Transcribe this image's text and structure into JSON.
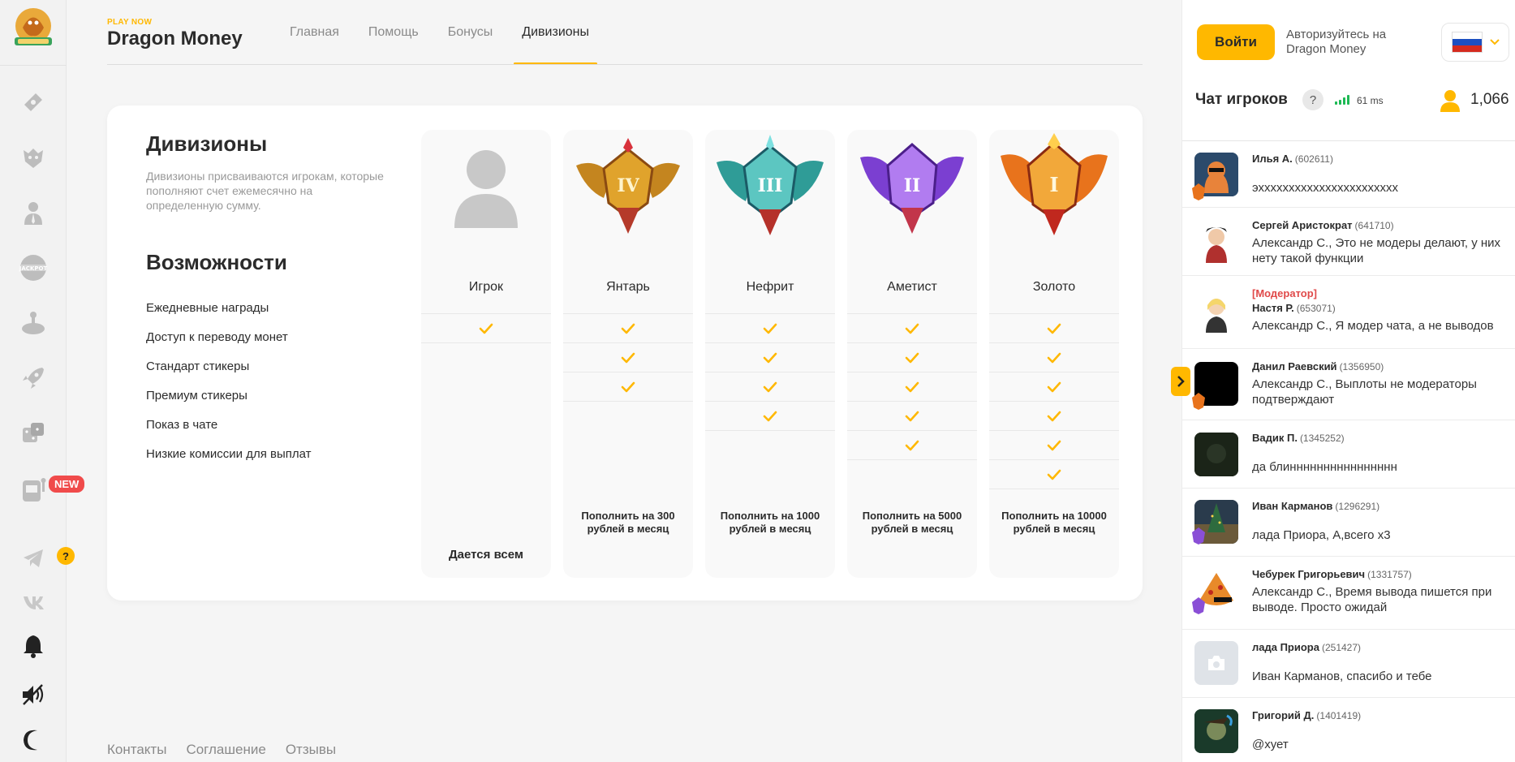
{
  "brand": {
    "small": "PLAY NOW",
    "name": "Dragon Money"
  },
  "nav": [
    "Главная",
    "Помощь",
    "Бонусы",
    "Дивизионы"
  ],
  "sidebar": {
    "icons": [
      "ticket-icon",
      "tiger-icon",
      "agent-icon",
      "jackpot-icon",
      "joystick-icon",
      "rocket-icon",
      "dice-icon",
      "slot-machine-icon"
    ],
    "new_badge": "NEW",
    "help_badge": "?",
    "bottom_icons": [
      "telegram-icon",
      "vk-icon",
      "bell-icon",
      "sound-off-icon",
      "moon-icon"
    ]
  },
  "card": {
    "title": "Дивизионы",
    "description": "Дивизионы присваиваются игрокам, которые пополняют счет ежемесячно на определенную сумму.",
    "features_title": "Возможности",
    "features": [
      "Ежедневные награды",
      "Доступ к переводу монет",
      "Стандарт стикеры",
      "Премиум стикеры",
      "Показ в чате",
      "Низкие комиссии для выплат"
    ],
    "divisions": [
      {
        "name": "Игрок",
        "requirement": "Дается всем",
        "checks": [
          true,
          false,
          false,
          false,
          false,
          false
        ]
      },
      {
        "name": "Янтарь",
        "roman": "IV",
        "requirement": "Пополнить на 300 рублей в месяц",
        "checks": [
          true,
          true,
          true,
          false,
          false,
          false
        ]
      },
      {
        "name": "Нефрит",
        "roman": "III",
        "requirement": "Пополнить на 1000 рублей в месяц",
        "checks": [
          true,
          true,
          true,
          true,
          false,
          false
        ]
      },
      {
        "name": "Аметист",
        "roman": "II",
        "requirement": "Пополнить на 5000 рублей в месяц",
        "checks": [
          true,
          true,
          true,
          true,
          true,
          false
        ]
      },
      {
        "name": "Золото",
        "roman": "I",
        "requirement": "Пополнить на 10000 рублей в месяц",
        "checks": [
          true,
          true,
          true,
          true,
          true,
          true
        ]
      }
    ]
  },
  "footer": [
    "Контакты",
    "Соглашение",
    "Отзывы"
  ],
  "chat": {
    "login_button": "Войти",
    "login_prompt": "Авторизуйтесь на Dragon Money",
    "title": "Чат игроков",
    "help": "?",
    "ping": "61 ms",
    "online": "1,066",
    "messages": [
      {
        "name": "Илья А.",
        "uid": "(602611)",
        "text": "эххххххххххххххххххххххх"
      },
      {
        "name": "Сергей Аристократ",
        "uid": "(641710)",
        "text": "Александр С., Это не модеры делают, у них нету такой функции"
      },
      {
        "role": "[Модератор]",
        "name": "Настя Р.",
        "uid": "(653071)",
        "text": "Александр С., Я модер чата, а не выводов"
      },
      {
        "name": "Данил Раевский",
        "uid": "(1356950)",
        "text": "Александр С., Выплоты не модераторы подтверждают"
      },
      {
        "name": "Вадик П.",
        "uid": "(1345252)",
        "text": "да блинннннннннннннннн"
      },
      {
        "name": "Иван Карманов",
        "uid": "(1296291)",
        "text": "лада Приора, А,всего х3"
      },
      {
        "name": "Чебурек Григорьевич",
        "uid": "(1331757)",
        "text": "Александр С., Время вывода пишется при выводе. Просто ожидай"
      },
      {
        "name": "лада Приора",
        "uid": "(251427)",
        "text": "Иван Карманов, спасибо и тебе"
      },
      {
        "name": "Григорий Д.",
        "uid": "(1401419)",
        "text": "@хует"
      }
    ]
  },
  "colors": {
    "accent": "#ffb800",
    "moderator": "#e04a4a",
    "ping": "#1db954"
  }
}
